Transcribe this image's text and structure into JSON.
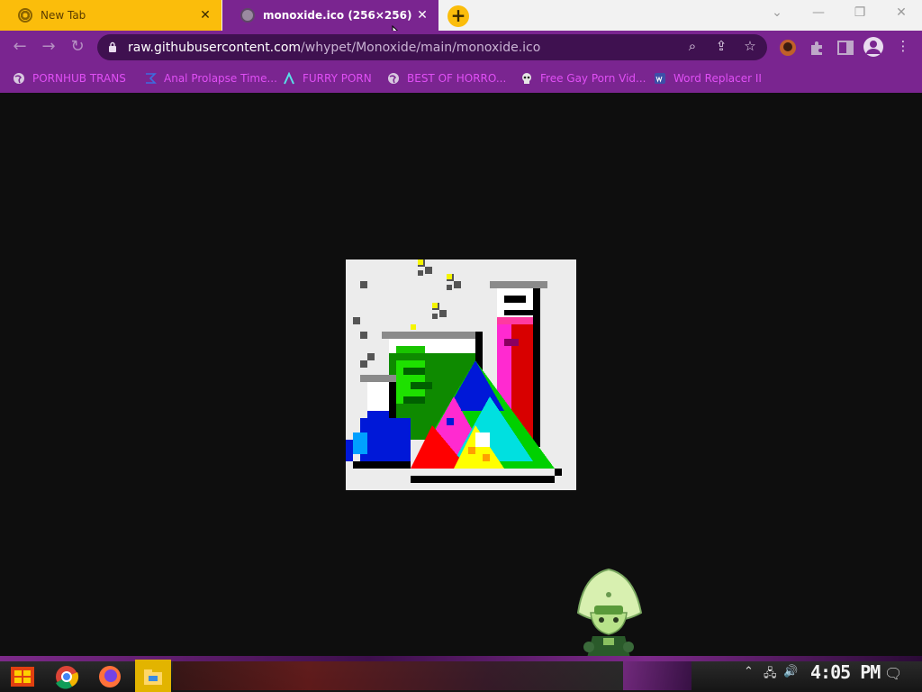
{
  "tabs": [
    {
      "title": "New Tab",
      "active": false
    },
    {
      "title": "monoxide.ico (256×256)",
      "active": true
    }
  ],
  "window_controls": {
    "minimize": "—",
    "restore": "❐",
    "close": "✕",
    "dropdown": "⌄"
  },
  "address": {
    "host": "raw.githubusercontent.com",
    "path": "/whypet/Monoxide/main/monoxide.ico"
  },
  "bookmarks": [
    {
      "label": "PORNHUB TRANS",
      "icon": "globe-icon"
    },
    {
      "label": "Anal Prolapse Time...",
      "icon": "sigma-icon"
    },
    {
      "label": "FURRY PORN",
      "icon": "lambda-icon"
    },
    {
      "label": "BEST OF HORRO...",
      "icon": "globe-icon"
    },
    {
      "label": "Free Gay Porn Vid...",
      "icon": "skull-icon"
    },
    {
      "label": "Word Replacer II",
      "icon": "wr-icon"
    }
  ],
  "taskbar": {
    "clock": "4:05 PM",
    "apps": [
      "start-button",
      "chrome",
      "firefox",
      "file-explorer"
    ]
  },
  "colors": {
    "browser_frame": "#7a2590",
    "tab_yellow": "#fbbd0b",
    "omnibox": "#3f1150",
    "bookmark_text": "#e04ff5",
    "page_bg": "#0e0e0e",
    "image_bg": "#ececec"
  }
}
